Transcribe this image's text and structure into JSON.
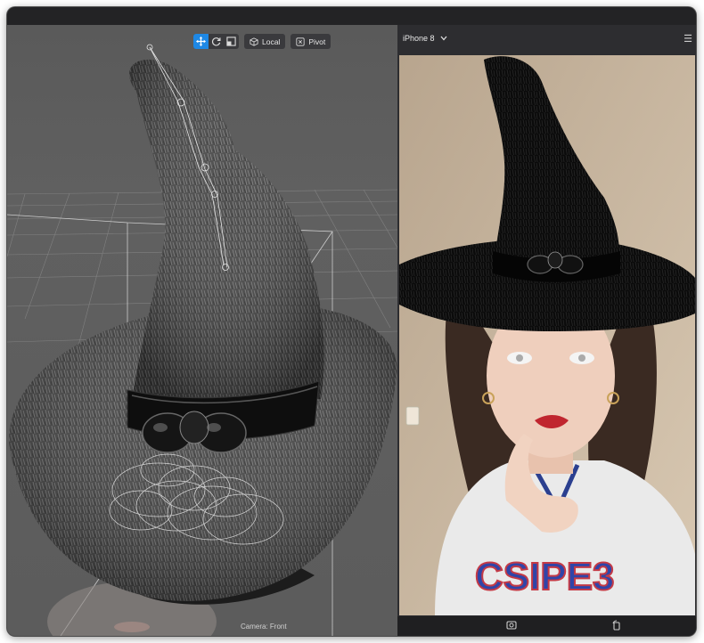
{
  "toolbar": {
    "move_icon": "move-arrows-icon",
    "rotate_icon": "rotate-icon",
    "scale_icon": "scale-icon",
    "local_label": "Local",
    "pivot_label": "Pivot"
  },
  "viewport": {
    "camera_label": "Camera: Front"
  },
  "preview": {
    "device_label": "iPhone 8",
    "menu_icon": "hamburger-menu-icon",
    "capture_icon": "capture-icon",
    "rotate_device_icon": "rotate-device-icon"
  },
  "colors": {
    "accent": "#1e88e5",
    "panel": "#2a2a2d",
    "viewport_bg": "#5e5e5e"
  }
}
